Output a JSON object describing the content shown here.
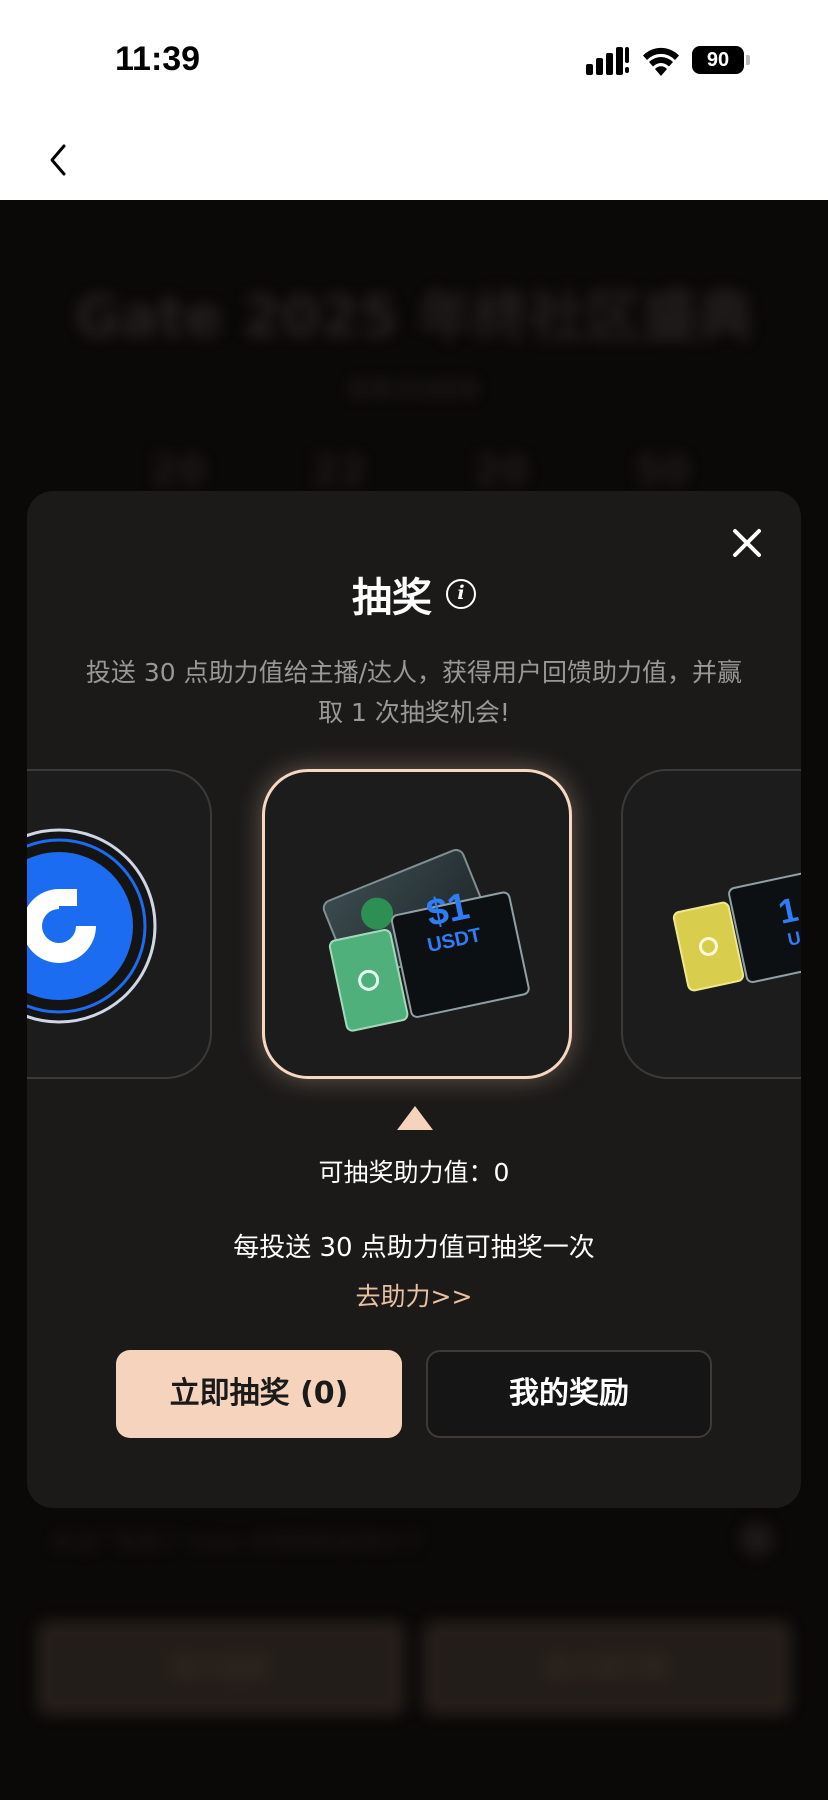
{
  "status_bar": {
    "time": "11:39",
    "battery_level": "90",
    "icons": [
      "signal-icon",
      "wifi-icon",
      "battery-icon"
    ]
  },
  "nav": {
    "back_icon": "chevron-left-icon"
  },
  "background": {
    "title": "Gate 2025 年终社区盛典",
    "subtitle": "距离活动结束",
    "countdown": [
      "20",
      "22",
      "20",
      "50"
    ],
    "bottom_text": "关注广告商了 Gate 对领奖机会有分了",
    "button_left": "助力抽奖",
    "button_right": "助力排行榜"
  },
  "modal": {
    "title": "抽奖",
    "info_icon": "info-icon",
    "close_icon": "close-icon",
    "description": "投送 30 点助力值给主播/达人，获得用户回馈助力值，并赢取 1 次抽奖机会!",
    "prizes": [
      {
        "name": "gate-coin",
        "label": ""
      },
      {
        "name": "usdt-voucher",
        "label": "$1",
        "sublabel": "USDT"
      },
      {
        "name": "yellow-voucher",
        "label": "1",
        "sublabel": "U"
      }
    ],
    "points_line": "可抽奖助力值：0",
    "rule_line": "每投送 30 点助力值可抽奖一次",
    "go_link": "去助力>>",
    "draw_button": "立即抽奖 (0)",
    "rewards_button": "我的奖励"
  },
  "colors": {
    "accent": "#f6d3bd",
    "link": "#e9c1a2",
    "modal_bg": "#1b1a19",
    "brand_blue": "#1c6cf2"
  }
}
